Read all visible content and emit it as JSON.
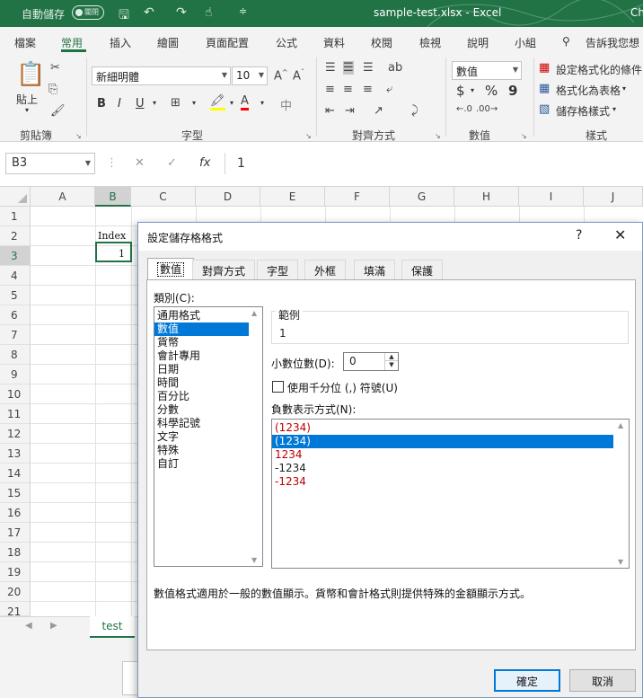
{
  "titlebar": {
    "autosave_label": "自動儲存",
    "autosave_state": "關閉",
    "filename": "sample-test.xlsx  -  Excel",
    "right_text": "Ch"
  },
  "ribbon_tabs": [
    "檔案",
    "常用",
    "插入",
    "繪圖",
    "頁面配置",
    "公式",
    "資料",
    "校閱",
    "檢視",
    "說明",
    "小組"
  ],
  "active_tab": "常用",
  "tell_me": "告訴我您想",
  "ribbon": {
    "paste_label": "貼上",
    "clipboard_label": "剪貼簿",
    "font_name": "新細明體",
    "font_size": "10",
    "font_label": "字型",
    "alignment_label": "對齊方式",
    "number_format": "數值",
    "number_label": "數值",
    "currency_symbol": "$",
    "percent_symbol": "%",
    "comma_symbol": "9",
    "conditional_format": "設定格式化的條件",
    "format_as_table": "格式化為表格",
    "cell_styles": "儲存格樣式",
    "styles_label": "樣式",
    "bold": "B",
    "italic": "I",
    "underline": "U",
    "font_color_glyph": "A"
  },
  "formula_bar": {
    "name_box": "B3",
    "fx": "fx",
    "value": "1"
  },
  "grid": {
    "columns": [
      "A",
      "B",
      "C",
      "D",
      "E",
      "F",
      "G",
      "H",
      "I",
      "J"
    ],
    "rows": [
      "1",
      "2",
      "3",
      "4",
      "5",
      "6",
      "7",
      "8",
      "9",
      "10",
      "11",
      "12",
      "13",
      "14",
      "15",
      "16",
      "17",
      "18",
      "19",
      "20",
      "21"
    ],
    "selected_column": "B",
    "selected_row": "3",
    "cells": {
      "B2": "Index",
      "B3": "1"
    }
  },
  "sheet_tab": "test",
  "dialog": {
    "title": "設定儲存格格式",
    "help": "?",
    "close": "✕",
    "tabs": [
      "數值",
      "對齊方式",
      "字型",
      "外框",
      "填滿",
      "保護"
    ],
    "active_tab": "數值",
    "category_label": "類別(C):",
    "categories": [
      "通用格式",
      "數值",
      "貨幣",
      "會計專用",
      "日期",
      "時間",
      "百分比",
      "分數",
      "科學記號",
      "文字",
      "特殊",
      "自訂"
    ],
    "selected_category": "數值",
    "sample_label": "範例",
    "sample_value": "1",
    "decimal_label": "小數位數(D):",
    "decimal_value": "0",
    "thousands_label": "使用千分位 (,) 符號(U)",
    "thousands_checked": false,
    "negative_label": "負數表示方式(N):",
    "negative_formats": [
      {
        "text": "(1234)",
        "red": true
      },
      {
        "text": "(1234)",
        "red": false
      },
      {
        "text": "1234",
        "red": true
      },
      {
        "text": "-1234",
        "red": false
      },
      {
        "text": "-1234",
        "red": true
      }
    ],
    "selected_negative_index": 1,
    "description": "數值格式適用於一般的數值顯示。貨幣和會計格式則提供特殊的金額顯示方式。",
    "ok": "確定",
    "cancel": "取消"
  }
}
